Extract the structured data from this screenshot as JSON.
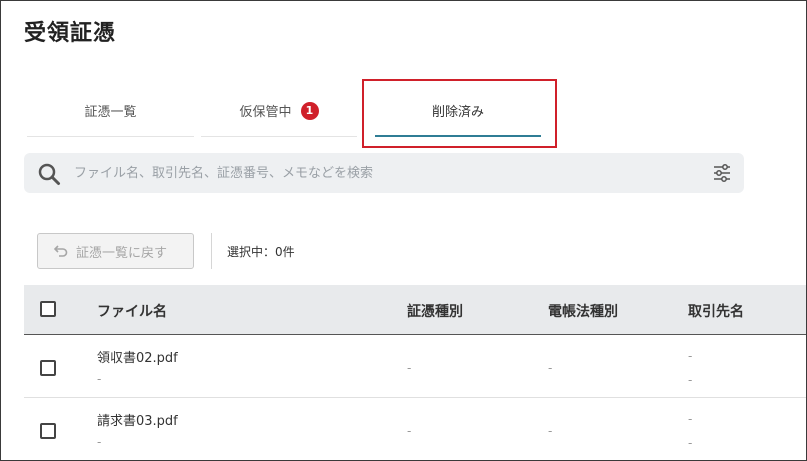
{
  "page": {
    "title": "受領証憑"
  },
  "tabs": [
    {
      "label": "証憑一覧",
      "active": false
    },
    {
      "label": "仮保管中",
      "badge": "1",
      "active": false
    },
    {
      "label": "削除済み",
      "active": true
    }
  ],
  "search": {
    "placeholder": "ファイル名、取引先名、証憑番号、メモなどを検索",
    "value": ""
  },
  "toolbar": {
    "back_label": "証憑一覧に戻す",
    "selection_text": "選択中：0件"
  },
  "table": {
    "columns": [
      "ファイル名",
      "証憑種別",
      "電帳法種別",
      "取引先名"
    ],
    "rows": [
      {
        "file_name": "領収書02.pdf",
        "file_sub": "-",
        "type": "-",
        "ledger_type": "-",
        "partner": "-",
        "partner_sub": "-"
      },
      {
        "file_name": "請求書03.pdf",
        "file_sub": "-",
        "type": "-",
        "ledger_type": "-",
        "partner": "-",
        "partner_sub": "-"
      }
    ]
  },
  "colors": {
    "accent": "#2f7d95",
    "badge": "#d0202a",
    "highlight": "#d0202a"
  },
  "icons": {
    "search": "search-icon",
    "filter": "filter-sliders-icon",
    "back": "undo-arrow-icon"
  }
}
